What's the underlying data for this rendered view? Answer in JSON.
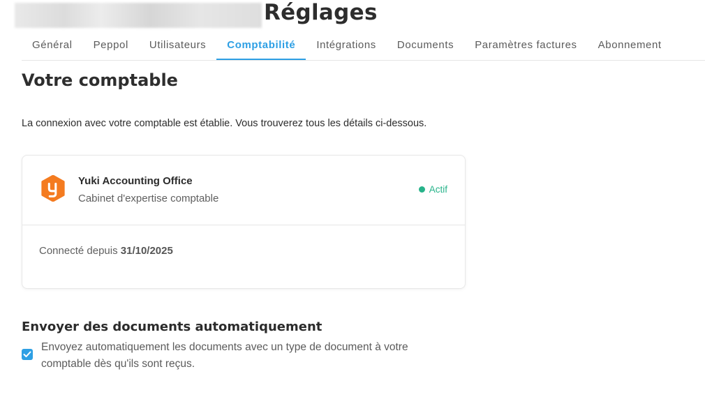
{
  "header": {
    "title": "Réglages"
  },
  "tabs": [
    {
      "label": "Général",
      "active": false
    },
    {
      "label": "Peppol",
      "active": false
    },
    {
      "label": "Utilisateurs",
      "active": false
    },
    {
      "label": "Comptabilité",
      "active": true
    },
    {
      "label": "Intégrations",
      "active": false
    },
    {
      "label": "Documents",
      "active": false
    },
    {
      "label": "Paramètres factures",
      "active": false
    },
    {
      "label": "Abonnement",
      "active": false
    }
  ],
  "main": {
    "section_title": "Votre comptable",
    "intro": "La connexion avec votre comptable est établie. Vous trouverez tous les détails ci-dessous.",
    "card": {
      "logo_icon": "yuki-logo-icon",
      "company_name": "Yuki Accounting Office",
      "company_type": "Cabinet d'expertise comptable",
      "status": "Actif",
      "connected_label": "Connecté depuis",
      "connected_date": "31/10/2025"
    },
    "auto_send": {
      "title": "Envoyer des documents automatiquement",
      "checked": true,
      "description": "Envoyez automatiquement les documents avec un type de document à votre comptable dès qu'ils sont reçus."
    }
  },
  "colors": {
    "accent": "#2d9fe4",
    "status_active": "#27b38a",
    "logo_orange": "#f47b20"
  }
}
